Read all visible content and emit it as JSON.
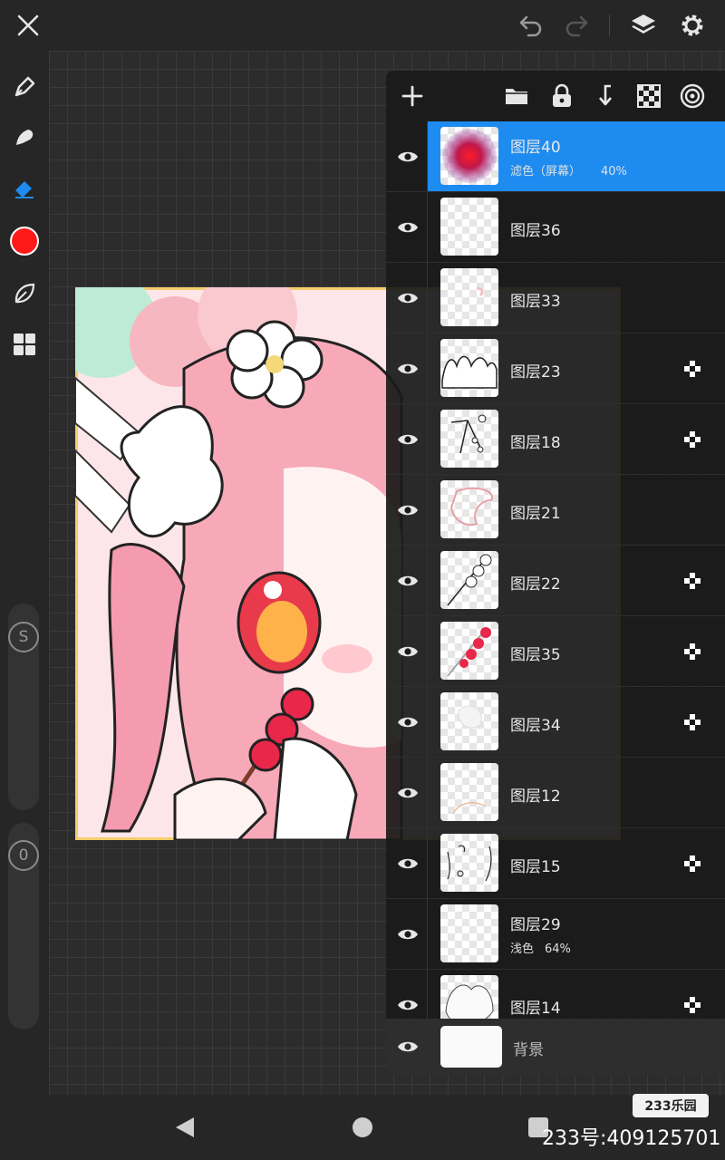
{
  "topbar": {
    "icons": [
      "close-icon",
      "undo-icon",
      "redo-icon",
      "layers-icon",
      "settings-icon"
    ]
  },
  "left_toolbar": {
    "tools": [
      "brush-icon",
      "smudge-icon",
      "eraser-icon",
      "color-swatch",
      "leaf-icon",
      "grid-icon"
    ],
    "current_color": "#ff1a1a",
    "size_slider_label": "S",
    "opacity_slider_label": "0"
  },
  "layer_panel": {
    "toolbar_icons": [
      "add-icon",
      "folder-icon",
      "lock-icon",
      "merge-down-icon",
      "checker-icon",
      "target-icon"
    ],
    "selected_color": "#1e8bf0",
    "layers": [
      {
        "name": "图层40",
        "blend": "滤色（屏幕）",
        "opacity": "40%",
        "selected": true,
        "alpha_lock": false
      },
      {
        "name": "图层36",
        "blend": "",
        "opacity": "",
        "selected": false,
        "alpha_lock": false
      },
      {
        "name": "图层33",
        "blend": "",
        "opacity": "",
        "selected": false,
        "alpha_lock": false
      },
      {
        "name": "图层23",
        "blend": "",
        "opacity": "",
        "selected": false,
        "alpha_lock": true
      },
      {
        "name": "图层18",
        "blend": "",
        "opacity": "",
        "selected": false,
        "alpha_lock": true
      },
      {
        "name": "图层21",
        "blend": "",
        "opacity": "",
        "selected": false,
        "alpha_lock": false
      },
      {
        "name": "图层22",
        "blend": "",
        "opacity": "",
        "selected": false,
        "alpha_lock": true
      },
      {
        "name": "图层35",
        "blend": "",
        "opacity": "",
        "selected": false,
        "alpha_lock": true
      },
      {
        "name": "图层34",
        "blend": "",
        "opacity": "",
        "selected": false,
        "alpha_lock": true
      },
      {
        "name": "图层12",
        "blend": "",
        "opacity": "",
        "selected": false,
        "alpha_lock": false
      },
      {
        "name": "图层15",
        "blend": "",
        "opacity": "",
        "selected": false,
        "alpha_lock": true
      },
      {
        "name": "图层29",
        "blend": "浅色",
        "opacity": "64%",
        "selected": false,
        "alpha_lock": false
      },
      {
        "name": "图层14",
        "blend": "",
        "opacity": "",
        "selected": false,
        "alpha_lock": true
      }
    ],
    "background_layer": {
      "name": "背景"
    }
  },
  "navbar": {
    "icons": [
      "back-icon",
      "home-icon",
      "recents-icon"
    ]
  },
  "watermark": {
    "badge": "233乐园",
    "id_text": "233号:409125701"
  }
}
